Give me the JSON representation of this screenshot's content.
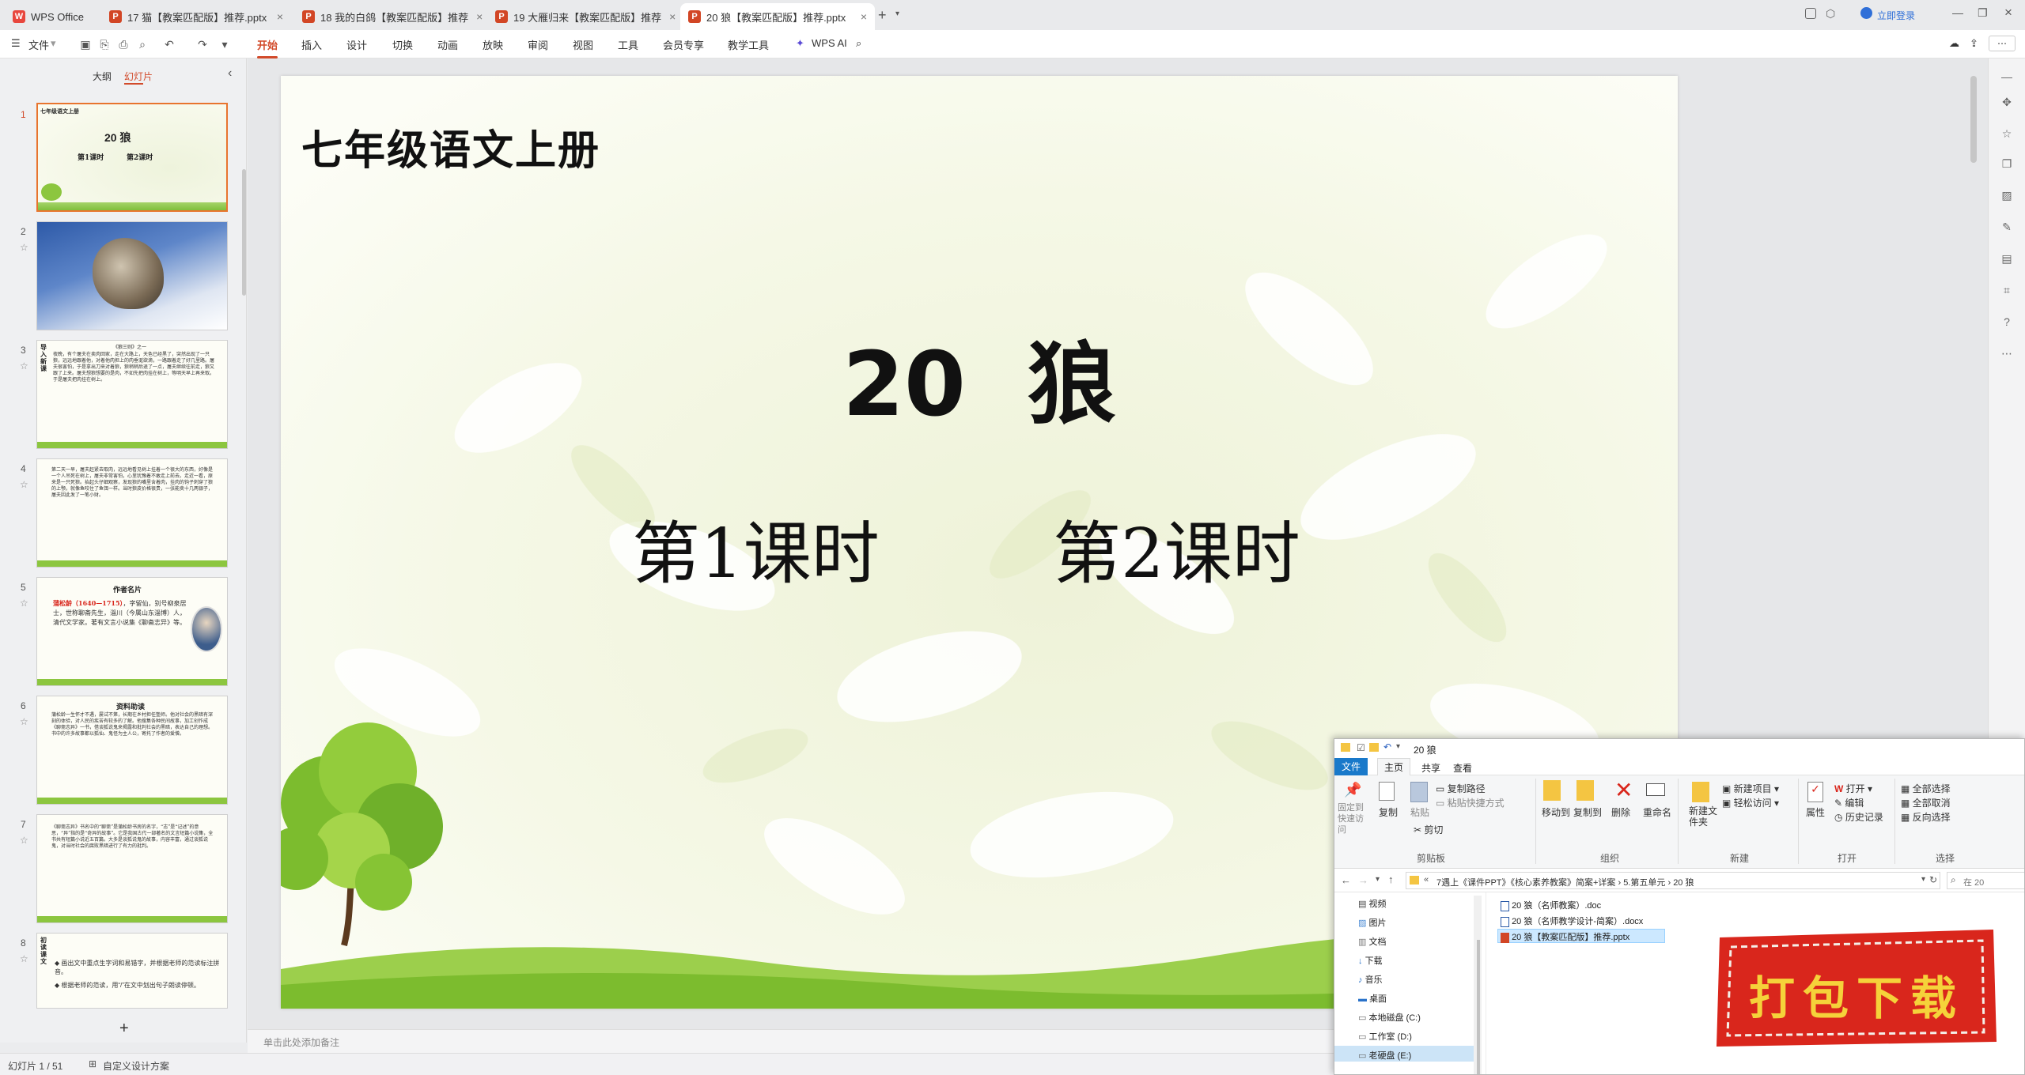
{
  "tabs": [
    {
      "label": "WPS Office"
    },
    {
      "label": "17 猫【教案匹配版】推荐.pptx"
    },
    {
      "label": "18 我的白鸽【教案匹配版】推荐"
    },
    {
      "label": "19 大雁归来【教案匹配版】推荐"
    },
    {
      "label": "20 狼【教案匹配版】推荐.pptx"
    }
  ],
  "titlebar": {
    "login": "立即登录"
  },
  "menu": {
    "file": "文件",
    "items": [
      "开始",
      "插入",
      "设计",
      "切换",
      "动画",
      "放映",
      "审阅",
      "视图",
      "工具",
      "会员专享",
      "教学工具"
    ],
    "ai": "WPS AI"
  },
  "panel": {
    "tab_outline": "大纲",
    "tab_slides": "幻灯片",
    "add": "+"
  },
  "thumbs": [
    {
      "num": "1",
      "header": "七年级语文上册",
      "title": "20 狼",
      "sub1": "第1课时",
      "sub2": "第2课时"
    },
    {
      "num": "2"
    },
    {
      "num": "3",
      "side": "导入新课",
      "head": "《狼三则》之一",
      "body": "夜晚，有个屠夫在卖肉回家，走在大路上，天色已经黑了，突然出现了一只狼，远远地跟着他，对着他肉担上的肉垂涎欲滴，一路跟着走了好几里路。屠夫很害怕，于是拿出刀来对着狼，狼稍稍后退了一点，屠夫继续往前走，狼又跟了上来。屠夫想狼想要的是肉，不如先把肉挂在树上，等明天早上再来取。于是屠夫把肉挂在树上。"
    },
    {
      "num": "4",
      "body": "第二天一早，屠夫赶紧去取肉，远远地看见树上挂着一个很大的东西，好像是一个人吊死在树上，屠夫非常害怕，心里犹豫着不敢走上前去。走近一看，原来是一只死狼。抬起头仔细观察，发现狼的嘴里含着肉，挂肉的钩子刺穿了狼的上颚，就像鱼咬住了鱼饵一样。当时狼皮价格很贵，一张能卖十几两银子，屠夫因此发了一笔小财。"
    },
    {
      "num": "5",
      "title": "作者名片",
      "name": "蒲松龄（1640—1715）",
      "body": "，字留仙，别号柳泉居士，世称聊斋先生，淄川（今属山东淄博）人，清代文学家。著有文言小说集《聊斋志异》等。"
    },
    {
      "num": "6",
      "title": "资料助读",
      "body": "蒲松龄一生怀才不遇，屡试不第，长期在乡村担任塾师。他对社会的黑暗有深刻的体验，对人民的疾苦有较多的了解。他搜集各种民间故事，加工创作成《聊斋志异》一书，借谈狐说鬼来揭露和批判社会的黑暗，表达自己的理想。书中的许多故事都以狐仙、鬼怪为主人公，寄托了作者的爱憎。"
    },
    {
      "num": "7",
      "body": "《聊斋志异》书名中的“聊斋”是蒲松龄书房的名字，“志”是“记述”的意思，“异”指的是“奇异的故事”。它是我国古代一部著名的文言短篇小说集，全书共有短篇小说近五百篇。大多是谈狐说鬼的故事，内容丰富，通过谈狐说鬼，对当时社会的腐败黑暗进行了有力的批判。"
    },
    {
      "num": "8",
      "side": "初读课文",
      "b1": "画出文中重点生字词和易错字，并根据老师的范读标注拼音。",
      "b2": "根据老师的范读，用“/”在文中划出句子朗读停顿。"
    }
  ],
  "slide": {
    "header": "七年级语文上册",
    "title": "20  狼",
    "lesson1": "第1课时",
    "lesson2": "第2课时"
  },
  "notes": {
    "placeholder": "单击此处添加备注"
  },
  "status": {
    "slide": "幻灯片 1 / 51",
    "design": "自定义设计方案"
  },
  "explorer": {
    "title": "20 狼",
    "tabs": [
      "文件",
      "主页",
      "共享",
      "查看"
    ],
    "ribbon": {
      "pin": "固定到快速访问",
      "copy": "复制",
      "paste": "粘贴",
      "copy_path": "复制路径",
      "paste_shortcut": "粘贴快捷方式",
      "cut": "剪切",
      "move_to": "移动到",
      "copy_to": "复制到",
      "delete": "删除",
      "rename": "重命名",
      "new_folder": "新建文件夹",
      "new_item": "新建项目",
      "easy_access": "轻松访问",
      "properties": "属性",
      "open": "打开",
      "edit": "编辑",
      "history": "历史记录",
      "select_all": "全部选择",
      "select_none": "全部取消",
      "invert": "反向选择"
    },
    "groups": [
      "剪贴板",
      "组织",
      "新建",
      "打开",
      "选择"
    ],
    "path": [
      "7遇上《课件PPT》《核心素养教案》简案+详案",
      "5.第五单元",
      "20 狼"
    ],
    "search": "在 20",
    "nav": [
      "视频",
      "图片",
      "文档",
      "下载",
      "音乐",
      "桌面",
      "本地磁盘 (C:)",
      "工作室 (D:)",
      "老硬盘 (E:)"
    ],
    "files": [
      "20 狼（名师教案）.doc",
      "20 狼（名师教学设计-简案）.docx",
      "20 狼【教案匹配版】推荐.pptx"
    ]
  },
  "badge": {
    "text": "打包下载"
  },
  "colors": {
    "accent": "#d24a2a",
    "badge_red": "#d9261c",
    "badge_text": "#f5d23a"
  }
}
